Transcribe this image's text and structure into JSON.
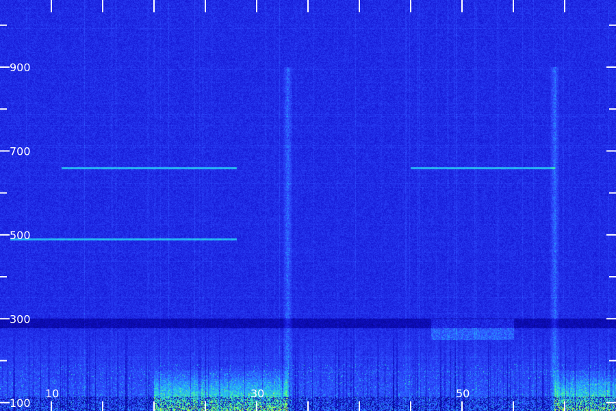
{
  "chart_data": {
    "type": "heatmap",
    "kind": "spectrogram",
    "title": "",
    "xlabel": "",
    "ylabel": "",
    "y_ticks": [
      "900",
      "700",
      "500",
      "300",
      "100"
    ],
    "y_tick_values": [
      900,
      700,
      500,
      300,
      100
    ],
    "x_ticks": [
      "10",
      "30",
      "50"
    ],
    "x_tick_values": [
      10,
      30,
      50
    ],
    "xlim": [
      5,
      65
    ],
    "ylim": [
      80,
      1060
    ],
    "colormap": [
      "#00007a",
      "#1414d2",
      "#2f4bff",
      "#24b6ff",
      "#40ff9a",
      "#e8ff20"
    ],
    "features": [
      {
        "kind": "tone",
        "y": 660,
        "x": [
          11,
          28
        ]
      },
      {
        "kind": "tone",
        "y": 660,
        "x": [
          45,
          59
        ]
      },
      {
        "kind": "tone",
        "y": 490,
        "x": [
          6,
          28
        ]
      },
      {
        "kind": "band-break",
        "y": 290
      },
      {
        "kind": "vertical-stripe",
        "x": 33
      },
      {
        "kind": "vertical-stripe",
        "x": 59
      },
      {
        "kind": "burst",
        "x": [
          47,
          55
        ],
        "y": [
          250,
          300
        ]
      },
      {
        "kind": "hot-region",
        "x": [
          20,
          33
        ],
        "y": [
          80,
          150
        ]
      },
      {
        "kind": "hot-region",
        "x": [
          59,
          65
        ],
        "y": [
          80,
          150
        ]
      }
    ]
  }
}
